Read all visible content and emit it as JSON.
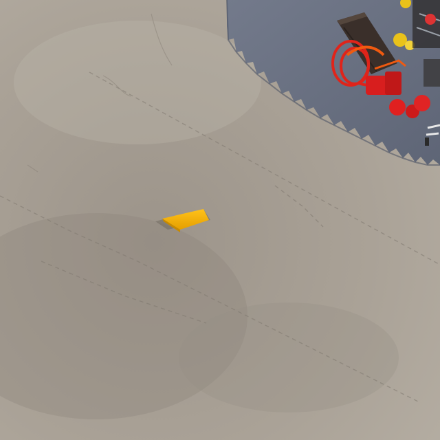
{
  "scene": {
    "description_visible_text": "",
    "colors": {
      "floor_light": "#b3ab9f",
      "floor_mid": "#a39b90",
      "floor_dark": "#8f877d",
      "blue_mat": "#6f7687",
      "blue_mat_dark": "#5a6172",
      "yellow_block": "#f5b400",
      "yellow_block_shade": "#d99800",
      "red_equipment": "#e02020",
      "orange_cable": "#f04a10",
      "dark_board": "#3a2f2a"
    },
    "objects": [
      {
        "name": "yellow-block",
        "label": ""
      },
      {
        "name": "red-cable-coil",
        "label": ""
      },
      {
        "name": "red-robot-parts",
        "label": ""
      },
      {
        "name": "dark-board",
        "label": ""
      },
      {
        "name": "blue-foam-mat",
        "label": ""
      }
    ]
  }
}
